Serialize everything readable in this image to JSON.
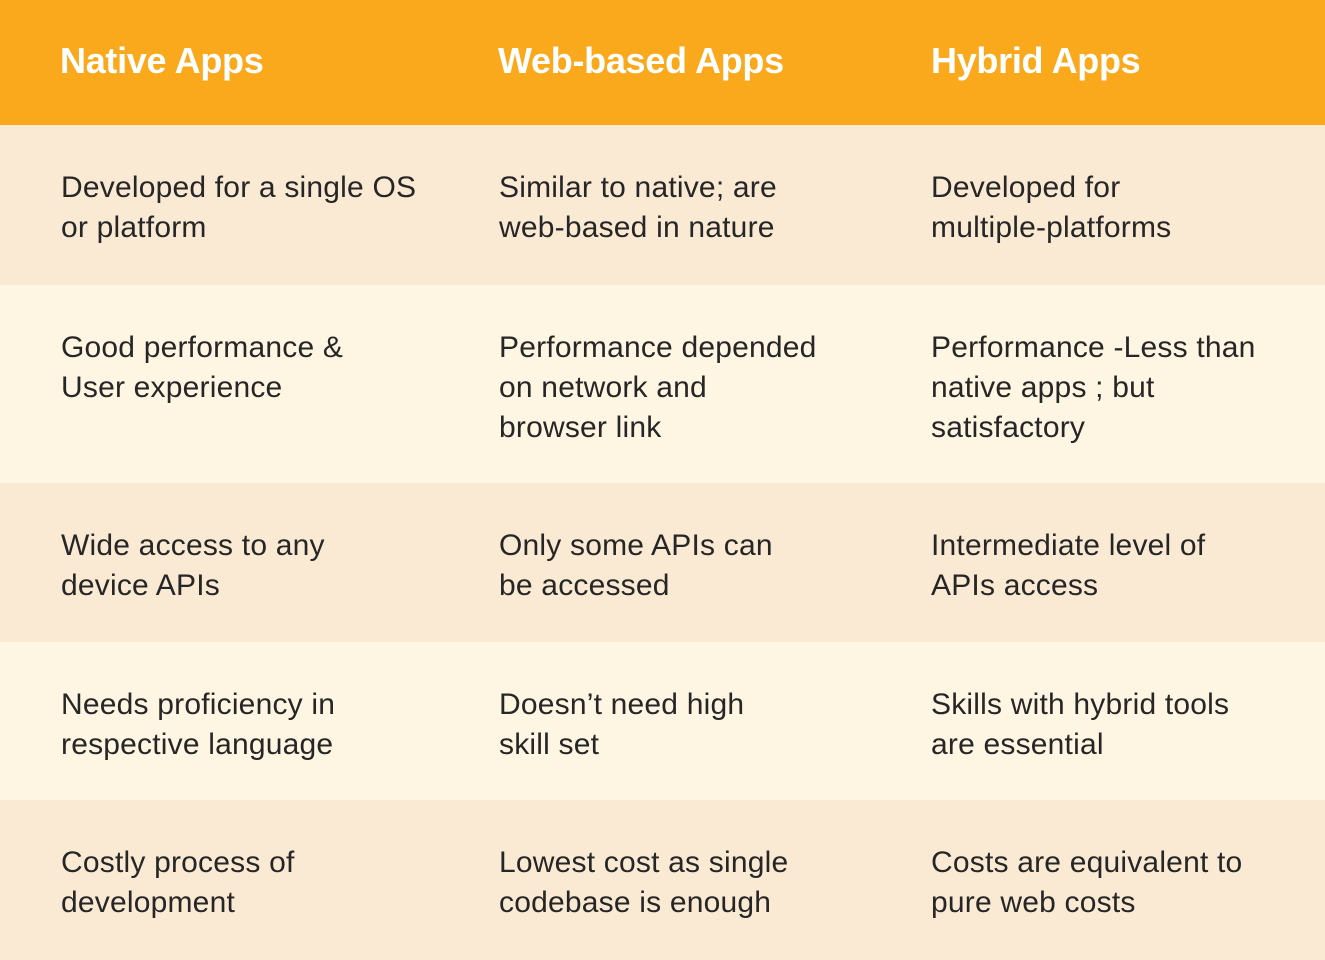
{
  "header": [
    "Native Apps",
    "Web-based Apps",
    "Hybrid Apps"
  ],
  "rows": [
    [
      [
        "Developed for a single OS",
        "or platform"
      ],
      [
        "Similar to native; are",
        "web-based in nature"
      ],
      [
        "Developed for",
        "multiple-platforms"
      ]
    ],
    [
      [
        "Good performance &",
        "User experience"
      ],
      [
        "Performance depended",
        "on network and",
        "browser link"
      ],
      [
        "Performance -Less than",
        "native apps ; but",
        "satisfactory"
      ]
    ],
    [
      [
        "Wide access to any",
        "device APIs"
      ],
      [
        "Only some APIs can",
        "be accessed"
      ],
      [
        "Intermediate level of",
        "APIs access"
      ]
    ],
    [
      [
        "Needs proficiency in",
        "respective language"
      ],
      [
        "Doesn’t need high",
        "skill set"
      ],
      [
        "Skills with hybrid tools",
        "are essential"
      ]
    ],
    [
      [
        "Costly process of",
        "development"
      ],
      [
        "Lowest cost as single",
        "codebase is enough"
      ],
      [
        "Costs are equivalent to",
        "pure web costs"
      ]
    ]
  ],
  "colors": {
    "header_bg": "#FBA91C",
    "row_dark": "#FAE9D3",
    "row_light": "#FEF5E3",
    "text": "#262626"
  }
}
